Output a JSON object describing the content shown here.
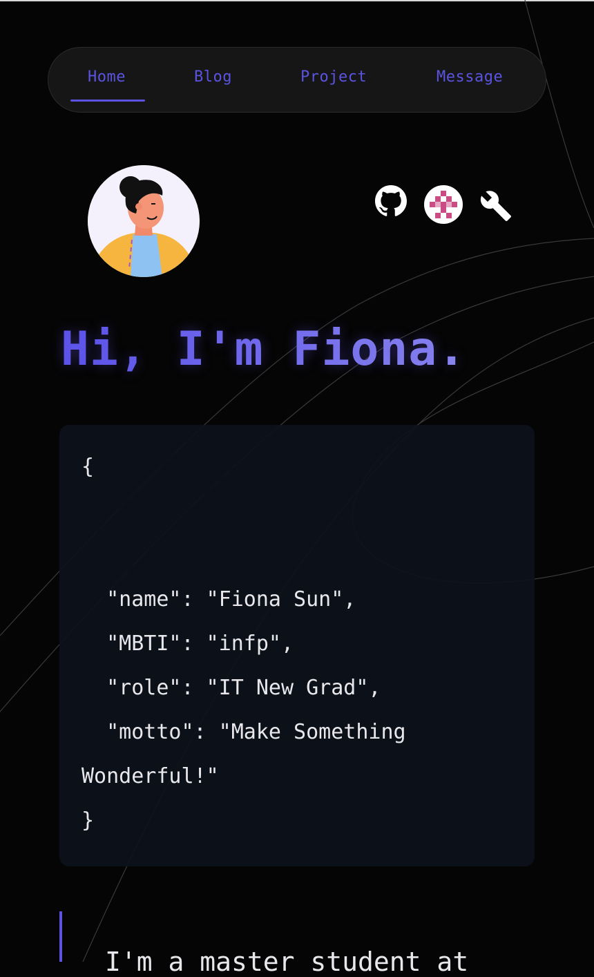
{
  "nav": {
    "items": [
      {
        "label": "Home",
        "active": true
      },
      {
        "label": "Blog",
        "active": false
      },
      {
        "label": "Project",
        "active": false
      },
      {
        "label": "Message",
        "active": false
      }
    ],
    "active_color": "#5a54e0"
  },
  "profile": {
    "avatar_icon": "person-avatar-illustration",
    "social_icons": [
      "github-icon",
      "pixel-logo-icon",
      "wrench-icon"
    ]
  },
  "hero": {
    "title": "Hi, I'm Fiona."
  },
  "code": {
    "open": "{",
    "lines": [
      "  \"name\": \"Fiona Sun\",",
      "  \"MBTI\": \"infp\",",
      "  \"role\": \"IT New Grad\",",
      "  \"motto\": \"Make Something",
      "Wonderful!\""
    ],
    "close": "}"
  },
  "intro": {
    "text": "I'm a master student at"
  },
  "colors": {
    "accent": "#5a54e0",
    "background": "#050505",
    "card": "#0d111a"
  }
}
